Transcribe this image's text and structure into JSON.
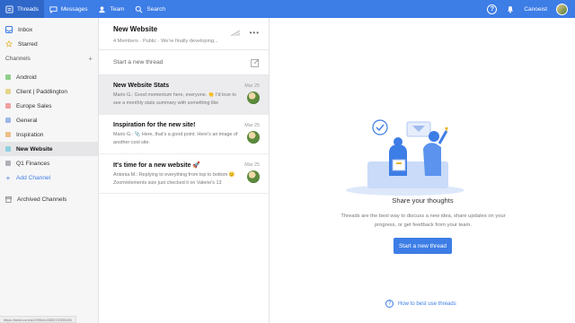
{
  "topbar": {
    "nav": [
      {
        "label": "Threads",
        "icon": "threads-icon",
        "active": true
      },
      {
        "label": "Messages",
        "icon": "messages-icon"
      },
      {
        "label": "Team",
        "icon": "team-icon"
      },
      {
        "label": "Search",
        "icon": "search-icon"
      }
    ],
    "help_icon": "?",
    "user_name": "Canoeist",
    "bg_color": "#3d7de6"
  },
  "sidebar": {
    "inbox": "Inbox",
    "starred": "Starred",
    "channels_header": "Channels",
    "channels": [
      {
        "label": "Android",
        "color": "#8fce8a"
      },
      {
        "label": "Client | Paddlington",
        "color": "#e6d48a"
      },
      {
        "label": "Europe Sales",
        "color": "#f0a0a0"
      },
      {
        "label": "General",
        "color": "#9fb6e6"
      },
      {
        "label": "Inspiration",
        "color": "#ecc08a"
      },
      {
        "label": "New Website",
        "color": "#8fd0e0",
        "selected": true
      },
      {
        "label": "Q1 Finances",
        "color": "#b0b0b8"
      }
    ],
    "add_channel": "Add Channel",
    "archived": "Archived Channels",
    "status_url": "https://twist.com/a/1995/ch/28037/t/395491"
  },
  "thread_list": {
    "channel_title": "New Website",
    "meta": "4 Members · Public · We're finally developing...",
    "new_thread_placeholder": "Start a new thread",
    "threads": [
      {
        "title": "New Website Stats",
        "date": "Mar 25",
        "snippet": "Mario G.: Good momentum here, everyone. 👏 I'd love to see a monthly stats summary with something like",
        "hover": true
      },
      {
        "title": "Inspiration for the new site!",
        "date": "Mar 25",
        "snippet": "Mario G.: 📎 Here, that's a good point. Here's an image of another cool site."
      },
      {
        "title": "It's time for a new website 🚀",
        "date": "Mar 25",
        "snippet": "Antonia M.: Replying to everything from top to bottom 😊 Zoom/elements size just checked it on Valerie's 13"
      }
    ]
  },
  "main": {
    "share_title": "Share your thoughts",
    "share_body": "Threads are the best way to discuss a new idea, share updates on your progress, or get feedback from your team.",
    "start_button": "Start a new thread",
    "howto": "How to best use threads"
  }
}
